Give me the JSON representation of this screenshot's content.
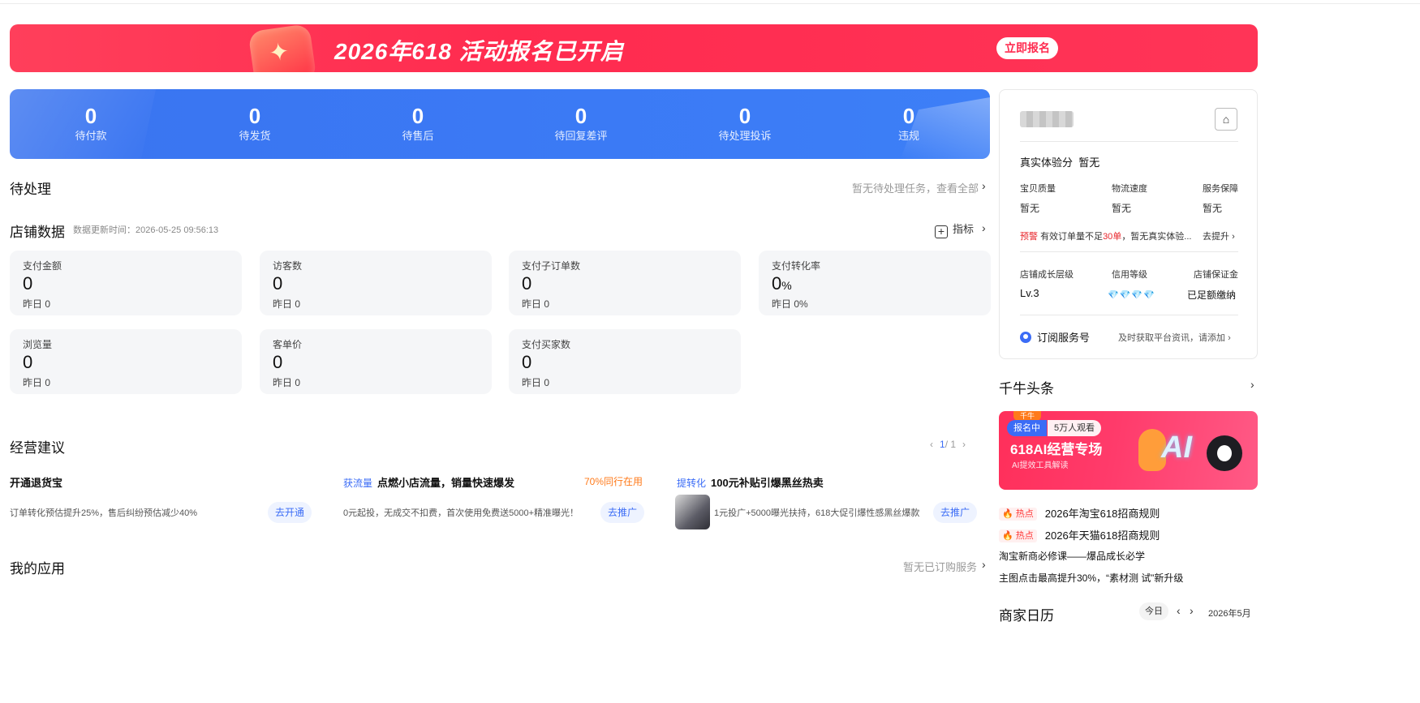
{
  "banner": {
    "title": "2026年618 活动报名已开启",
    "cta": "立即报名",
    "colors": {
      "bg": "#ff2b4f",
      "cta_text": "#ff2b4f"
    }
  },
  "stats": [
    {
      "value": "0",
      "label": "待付款"
    },
    {
      "value": "0",
      "label": "待发货"
    },
    {
      "value": "0",
      "label": "待售后"
    },
    {
      "value": "0",
      "label": "待回复差评"
    },
    {
      "value": "0",
      "label": "待处理投诉"
    },
    {
      "value": "0",
      "label": "违规"
    }
  ],
  "pending": {
    "title": "待处理",
    "link": "暂无待处理任务，查看全部"
  },
  "shop_data": {
    "title": "店铺数据",
    "update_time": "数据更新时间：2026-05-25 09:56:13",
    "indicator_label": "指标",
    "cards": [
      {
        "label": "支付金额",
        "value": "0",
        "unit": "",
        "prev": "昨日  0"
      },
      {
        "label": "访客数",
        "value": "0",
        "unit": "",
        "prev": "昨日  0"
      },
      {
        "label": "支付子订单数",
        "value": "0",
        "unit": "",
        "prev": "昨日  0"
      },
      {
        "label": "支付转化率",
        "value": "0",
        "unit": "%",
        "prev": "昨日  0%"
      },
      {
        "label": "浏览量",
        "value": "0",
        "unit": "",
        "prev": "昨日  0"
      },
      {
        "label": "客单价",
        "value": "0",
        "unit": "",
        "prev": "昨日  0"
      },
      {
        "label": "支付买家数",
        "value": "0",
        "unit": "",
        "prev": "昨日  0"
      }
    ]
  },
  "suggestions": {
    "title": "经营建议",
    "pager_current": "1",
    "pager_total": "/ 1",
    "items": [
      {
        "tag": "",
        "title": "开通退货宝",
        "hot": "",
        "desc": "订单转化预估提升25%，售后纠纷预估减少40%",
        "button": "去开通"
      },
      {
        "tag": "获流量",
        "title": "点燃小店流量，销量快速爆发",
        "hot": "70%同行在用",
        "desc": "0元起投，无成交不扣费，首次使用免费送5000+精准曝光！",
        "button": "去推广"
      },
      {
        "tag": "提转化",
        "title": "100元补贴引爆黑丝热卖",
        "hot": "",
        "desc": "1元投广+5000曝光扶持，618大促引爆性感黑丝爆款",
        "button": "去推广"
      }
    ]
  },
  "my_apps": {
    "title": "我的应用",
    "link": "暂无已订购服务"
  },
  "right_panel": {
    "experience_label": "真实体验分",
    "experience_value": "暂无",
    "metrics": [
      {
        "label": "宝贝质量",
        "value": "暂无"
      },
      {
        "label": "物流速度",
        "value": "暂无"
      },
      {
        "label": "服务保障",
        "value": "暂无"
      }
    ],
    "warning_prefix": "预警",
    "warning_text_1": "有效订单量不足",
    "warning_highlight": "30单",
    "warning_text_2": "，暂无真实体验...",
    "warning_action": "去提升",
    "levels": [
      {
        "label": "店铺成长层级",
        "value": "Lv.3"
      },
      {
        "label": "信用等级",
        "value": "💎💎💎💎"
      },
      {
        "label": "店铺保证金",
        "value": "已足额缴纳"
      }
    ],
    "subscribe_label": "订阅服务号",
    "subscribe_hint": "及时获取平台资讯，请添加"
  },
  "headlines": {
    "title": "千牛头条",
    "banner": {
      "logo": "千牛",
      "tag_status": "报名中",
      "tag_viewers": "5万人观看",
      "main": "618AI经营专场",
      "sub": "AI提效工具解读",
      "art_text": "AI"
    },
    "items": [
      {
        "hot": "热点",
        "text": "2026年淘宝618招商规则"
      },
      {
        "hot": "热点",
        "text": "2026年天猫618招商规则"
      },
      {
        "hot": "",
        "text": "淘宝新商必修课——爆品成长必学"
      },
      {
        "hot": "",
        "text": "主图点击最高提升30%，“素材测 试”新升级"
      }
    ]
  },
  "calendar": {
    "title": "商家日历",
    "today": "今日",
    "month": "2026年5月"
  },
  "icons": {
    "home": "home-icon",
    "chevron": "chevron-right-icon",
    "plus": "plus-square-icon",
    "fire": "fire-icon",
    "user": "user-circle-icon"
  }
}
